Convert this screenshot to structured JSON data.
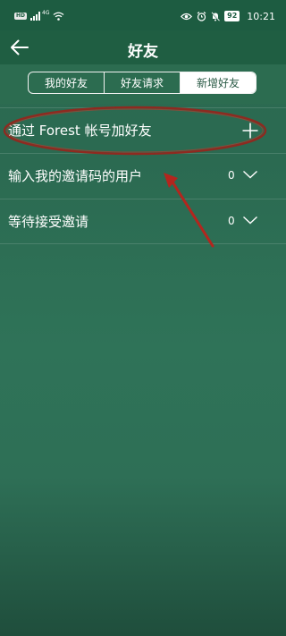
{
  "status_bar": {
    "hd_badge": "HD",
    "network": "4G",
    "battery": "92",
    "time": "10:21"
  },
  "header": {
    "title": "好友"
  },
  "tabs": [
    {
      "label": "我的好友",
      "active": false
    },
    {
      "label": "好友请求",
      "active": false
    },
    {
      "label": "新增好友",
      "active": true
    }
  ],
  "rows": [
    {
      "label": "通过 Forest 帐号加好友",
      "icon": "plus-icon"
    },
    {
      "label": "输入我的邀请码的用户",
      "count": "0",
      "icon": "chevron-down-icon"
    },
    {
      "label": "等待接受邀请",
      "count": "0",
      "icon": "chevron-down-icon"
    }
  ],
  "colors": {
    "header_bg": "#1f5e42",
    "page_bg": "#2c6b50",
    "annotation": "#c0392b"
  }
}
